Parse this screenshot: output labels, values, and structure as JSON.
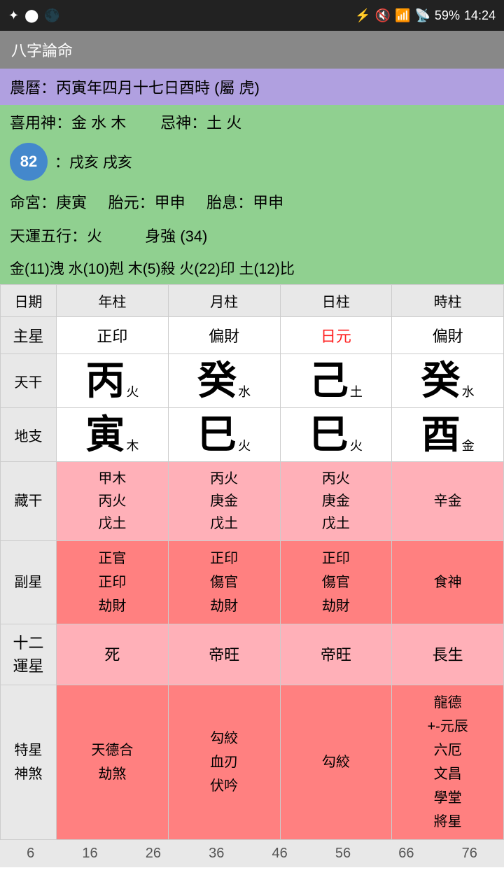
{
  "statusBar": {
    "time": "14:24",
    "battery": "59%",
    "signal": "▲",
    "wifi": "wifi"
  },
  "titleBar": {
    "title": "八字論命"
  },
  "info": {
    "lunarDate": "農曆：丙寅年四月十七日酉時 (屬 虎)",
    "xiyong": "喜用神：金 水 木",
    "jishen": "忌神：土 火",
    "badge": "82",
    "nayin": "：戌亥 戌亥",
    "minggong": "命宮：庚寅",
    "taiyuan": "胎元：甲申",
    "taixi": "胎息：甲申",
    "tianyun": "天運五行：火",
    "shengqiang": "身強 (34)",
    "fiveElements": "金(11)洩  水(10)剋  木(5)殺  火(22)印  土(12)比"
  },
  "tableHeaders": [
    "日期",
    "年柱",
    "月柱",
    "日柱",
    "時柱"
  ],
  "rows": {
    "zhuxing": {
      "label": "主星",
      "nian": "正印",
      "yue": "偏財",
      "ri": "日元",
      "shi": "偏財",
      "riIsRed": true
    },
    "tiangan": {
      "label": "天干",
      "nian": {
        "char": "丙",
        "sub": "火"
      },
      "yue": {
        "char": "癸",
        "sub": "水"
      },
      "ri": {
        "char": "己",
        "sub": "土"
      },
      "shi": {
        "char": "癸",
        "sub": "水"
      }
    },
    "dizhi": {
      "label": "地支",
      "nian": {
        "char": "寅",
        "sub": "木"
      },
      "yue": {
        "char": "巳",
        "sub": "火"
      },
      "ri": {
        "char": "巳",
        "sub": "火"
      },
      "shi": {
        "char": "酉",
        "sub": "金"
      }
    },
    "zanggan": {
      "label": "藏干",
      "nian": "甲木\n丙火\n戊土",
      "yue": "丙火\n庚金\n戊土",
      "ri": "丙火\n庚金\n戊土",
      "shi": "辛金"
    },
    "fuxing": {
      "label": "副星",
      "nian": "正官\n正印\n劫財",
      "yue": "正印\n傷官\n劫財",
      "ri": "正印\n傷官\n劫財",
      "shi": "食神"
    },
    "yunxing": {
      "label": "十二\n運星",
      "nian": "死",
      "yue": "帝旺",
      "ri": "帝旺",
      "shi": "長生"
    },
    "texing": {
      "label": "特星\n神煞",
      "nian": "天德合\n劫煞",
      "yue": "勾絞\n血刃\n伏吟",
      "ri": "勾絞",
      "shi": "龍德\n+-元辰\n六厄\n文昌\n學堂\n將星"
    }
  },
  "bottomNumbers": [
    "6",
    "16",
    "26",
    "36",
    "46",
    "56",
    "66",
    "76"
  ]
}
